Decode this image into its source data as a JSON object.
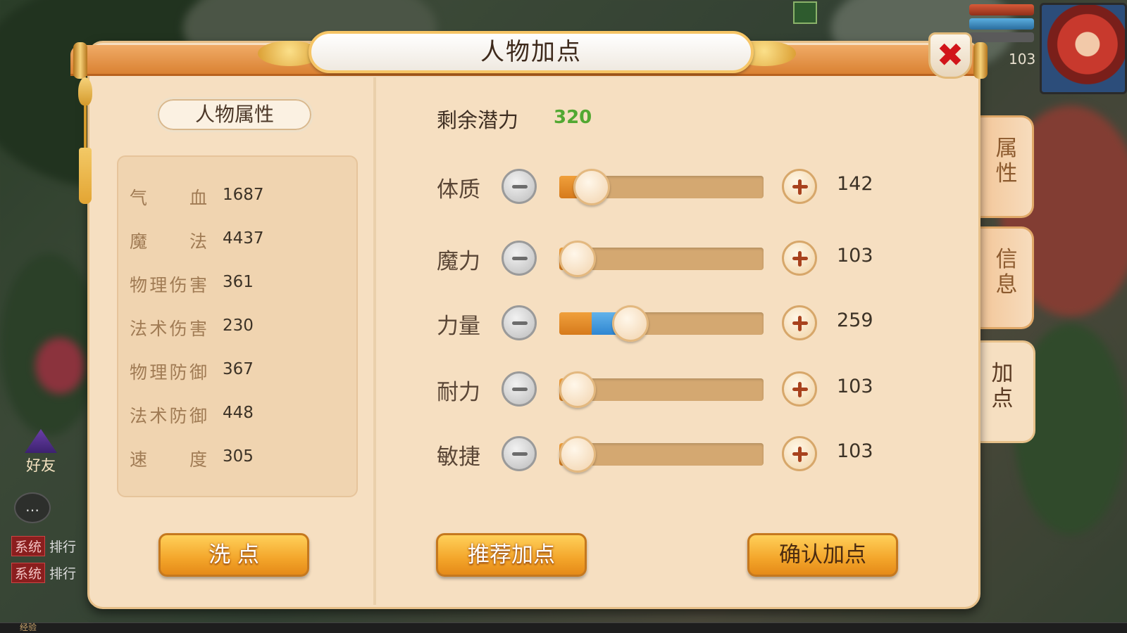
{
  "hud": {
    "friend_label": "好友",
    "chat_icon": "chat-bubble-icon",
    "system_tag": "系统",
    "system_rows": [
      "排行",
      "排行"
    ],
    "exp_label": "经验",
    "level": "103"
  },
  "window": {
    "title": "人物加点",
    "close_icon": "close-x-icon"
  },
  "attributes": {
    "title": "人物属性",
    "rows": [
      {
        "label": "气血",
        "value": "1687"
      },
      {
        "label": "魔法",
        "value": "4437"
      },
      {
        "label": "物理伤害",
        "value": "361"
      },
      {
        "label": "法术伤害",
        "value": "230"
      },
      {
        "label": "物理防御",
        "value": "367"
      },
      {
        "label": "法术防御",
        "value": "448"
      },
      {
        "label": "速度",
        "value": "305"
      }
    ],
    "reset_button": "洗 点"
  },
  "points": {
    "potential_label": "剩余潜力",
    "potential_value": "320",
    "stats": [
      {
        "name": "体质",
        "value": "142",
        "base_fraction": 0.16,
        "added_fraction": 0.0
      },
      {
        "name": "魔力",
        "value": "103",
        "base_fraction": 0.03,
        "added_fraction": 0.0
      },
      {
        "name": "力量",
        "value": "259",
        "base_fraction": 0.16,
        "added_fraction": 0.19
      },
      {
        "name": "耐力",
        "value": "103",
        "base_fraction": 0.03,
        "added_fraction": 0.0
      },
      {
        "name": "敏捷",
        "value": "103",
        "base_fraction": 0.03,
        "added_fraction": 0.0
      }
    ],
    "recommend_button": "推荐加点",
    "confirm_button": "确认加点"
  },
  "tabs": [
    {
      "label": "属性",
      "active": false
    },
    {
      "label": "信息",
      "active": false
    },
    {
      "label": "加点",
      "active": true
    }
  ],
  "colors": {
    "potential_value": "#52a832",
    "slider_base": "#e68a22",
    "slider_added": "#3d93d8",
    "close_x": "#d1141a"
  }
}
